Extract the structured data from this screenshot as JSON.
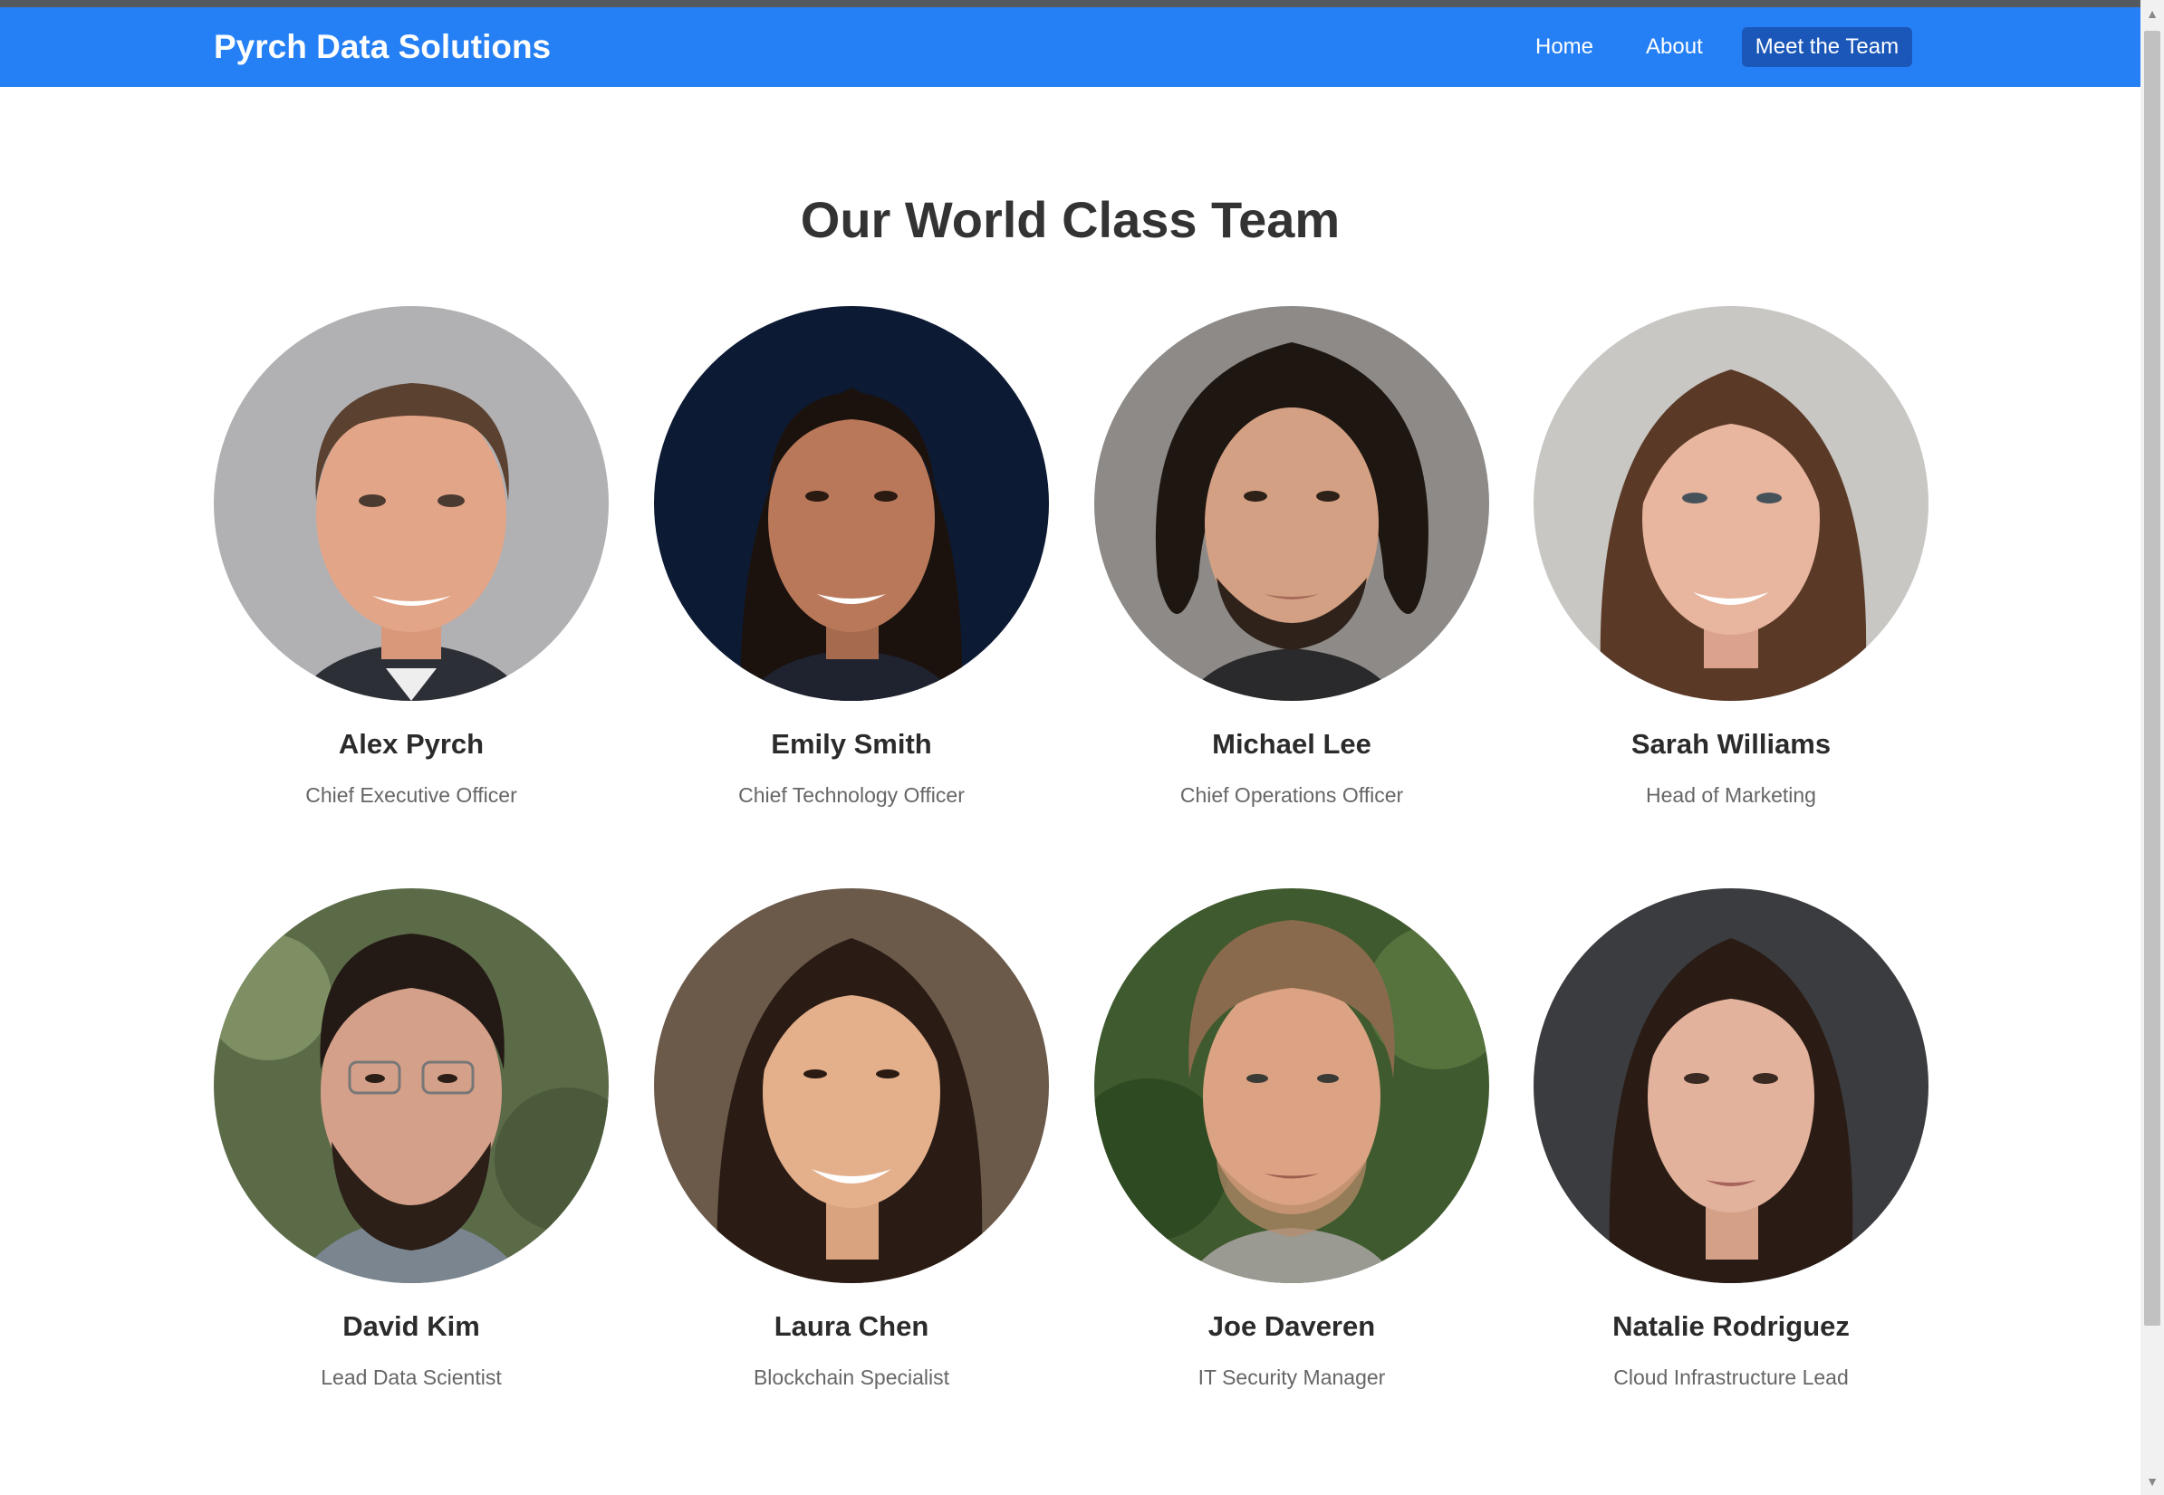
{
  "header": {
    "brand": "Pyrch Data Solutions",
    "nav": [
      {
        "label": "Home",
        "active": false
      },
      {
        "label": "About",
        "active": false
      },
      {
        "label": "Meet the Team",
        "active": true
      }
    ]
  },
  "main": {
    "title": "Our World Class Team",
    "members": [
      {
        "name": "Alex Pyrch",
        "role": "Chief Executive Officer"
      },
      {
        "name": "Emily Smith",
        "role": "Chief Technology Officer"
      },
      {
        "name": "Michael Lee",
        "role": "Chief Operations Officer"
      },
      {
        "name": "Sarah Williams",
        "role": "Head of Marketing"
      },
      {
        "name": "David Kim",
        "role": "Lead Data Scientist"
      },
      {
        "name": "Laura Chen",
        "role": "Blockchain Specialist"
      },
      {
        "name": "Joe Daveren",
        "role": "IT Security Manager"
      },
      {
        "name": "Natalie Rodriguez",
        "role": "Cloud Infrastructure Lead"
      }
    ]
  },
  "colors": {
    "navbar": "#2680f5",
    "active_nav": "#1a57b8",
    "heading": "#333333",
    "role_text": "#666666"
  }
}
